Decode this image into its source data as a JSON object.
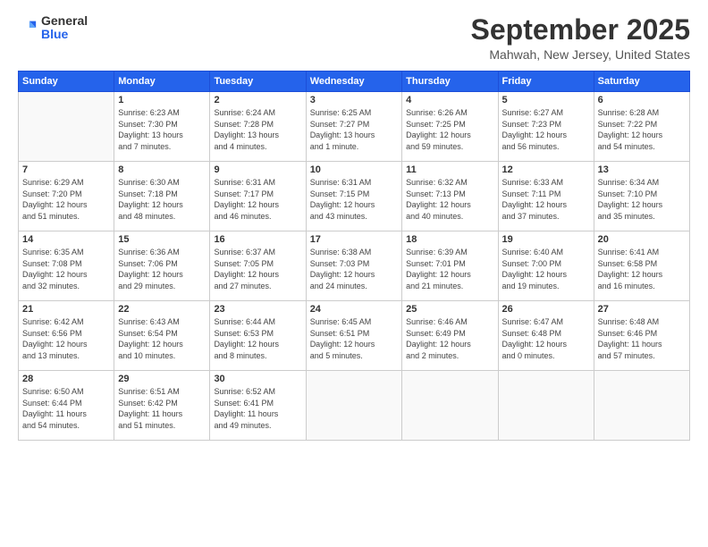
{
  "logo": {
    "general": "General",
    "blue": "Blue"
  },
  "title": "September 2025",
  "location": "Mahwah, New Jersey, United States",
  "days_of_week": [
    "Sunday",
    "Monday",
    "Tuesday",
    "Wednesday",
    "Thursday",
    "Friday",
    "Saturday"
  ],
  "weeks": [
    [
      {
        "day": "",
        "info": ""
      },
      {
        "day": "1",
        "info": "Sunrise: 6:23 AM\nSunset: 7:30 PM\nDaylight: 13 hours\nand 7 minutes."
      },
      {
        "day": "2",
        "info": "Sunrise: 6:24 AM\nSunset: 7:28 PM\nDaylight: 13 hours\nand 4 minutes."
      },
      {
        "day": "3",
        "info": "Sunrise: 6:25 AM\nSunset: 7:27 PM\nDaylight: 13 hours\nand 1 minute."
      },
      {
        "day": "4",
        "info": "Sunrise: 6:26 AM\nSunset: 7:25 PM\nDaylight: 12 hours\nand 59 minutes."
      },
      {
        "day": "5",
        "info": "Sunrise: 6:27 AM\nSunset: 7:23 PM\nDaylight: 12 hours\nand 56 minutes."
      },
      {
        "day": "6",
        "info": "Sunrise: 6:28 AM\nSunset: 7:22 PM\nDaylight: 12 hours\nand 54 minutes."
      }
    ],
    [
      {
        "day": "7",
        "info": "Sunrise: 6:29 AM\nSunset: 7:20 PM\nDaylight: 12 hours\nand 51 minutes."
      },
      {
        "day": "8",
        "info": "Sunrise: 6:30 AM\nSunset: 7:18 PM\nDaylight: 12 hours\nand 48 minutes."
      },
      {
        "day": "9",
        "info": "Sunrise: 6:31 AM\nSunset: 7:17 PM\nDaylight: 12 hours\nand 46 minutes."
      },
      {
        "day": "10",
        "info": "Sunrise: 6:31 AM\nSunset: 7:15 PM\nDaylight: 12 hours\nand 43 minutes."
      },
      {
        "day": "11",
        "info": "Sunrise: 6:32 AM\nSunset: 7:13 PM\nDaylight: 12 hours\nand 40 minutes."
      },
      {
        "day": "12",
        "info": "Sunrise: 6:33 AM\nSunset: 7:11 PM\nDaylight: 12 hours\nand 37 minutes."
      },
      {
        "day": "13",
        "info": "Sunrise: 6:34 AM\nSunset: 7:10 PM\nDaylight: 12 hours\nand 35 minutes."
      }
    ],
    [
      {
        "day": "14",
        "info": "Sunrise: 6:35 AM\nSunset: 7:08 PM\nDaylight: 12 hours\nand 32 minutes."
      },
      {
        "day": "15",
        "info": "Sunrise: 6:36 AM\nSunset: 7:06 PM\nDaylight: 12 hours\nand 29 minutes."
      },
      {
        "day": "16",
        "info": "Sunrise: 6:37 AM\nSunset: 7:05 PM\nDaylight: 12 hours\nand 27 minutes."
      },
      {
        "day": "17",
        "info": "Sunrise: 6:38 AM\nSunset: 7:03 PM\nDaylight: 12 hours\nand 24 minutes."
      },
      {
        "day": "18",
        "info": "Sunrise: 6:39 AM\nSunset: 7:01 PM\nDaylight: 12 hours\nand 21 minutes."
      },
      {
        "day": "19",
        "info": "Sunrise: 6:40 AM\nSunset: 7:00 PM\nDaylight: 12 hours\nand 19 minutes."
      },
      {
        "day": "20",
        "info": "Sunrise: 6:41 AM\nSunset: 6:58 PM\nDaylight: 12 hours\nand 16 minutes."
      }
    ],
    [
      {
        "day": "21",
        "info": "Sunrise: 6:42 AM\nSunset: 6:56 PM\nDaylight: 12 hours\nand 13 minutes."
      },
      {
        "day": "22",
        "info": "Sunrise: 6:43 AM\nSunset: 6:54 PM\nDaylight: 12 hours\nand 10 minutes."
      },
      {
        "day": "23",
        "info": "Sunrise: 6:44 AM\nSunset: 6:53 PM\nDaylight: 12 hours\nand 8 minutes."
      },
      {
        "day": "24",
        "info": "Sunrise: 6:45 AM\nSunset: 6:51 PM\nDaylight: 12 hours\nand 5 minutes."
      },
      {
        "day": "25",
        "info": "Sunrise: 6:46 AM\nSunset: 6:49 PM\nDaylight: 12 hours\nand 2 minutes."
      },
      {
        "day": "26",
        "info": "Sunrise: 6:47 AM\nSunset: 6:48 PM\nDaylight: 12 hours\nand 0 minutes."
      },
      {
        "day": "27",
        "info": "Sunrise: 6:48 AM\nSunset: 6:46 PM\nDaylight: 11 hours\nand 57 minutes."
      }
    ],
    [
      {
        "day": "28",
        "info": "Sunrise: 6:50 AM\nSunset: 6:44 PM\nDaylight: 11 hours\nand 54 minutes."
      },
      {
        "day": "29",
        "info": "Sunrise: 6:51 AM\nSunset: 6:42 PM\nDaylight: 11 hours\nand 51 minutes."
      },
      {
        "day": "30",
        "info": "Sunrise: 6:52 AM\nSunset: 6:41 PM\nDaylight: 11 hours\nand 49 minutes."
      },
      {
        "day": "",
        "info": ""
      },
      {
        "day": "",
        "info": ""
      },
      {
        "day": "",
        "info": ""
      },
      {
        "day": "",
        "info": ""
      }
    ]
  ]
}
